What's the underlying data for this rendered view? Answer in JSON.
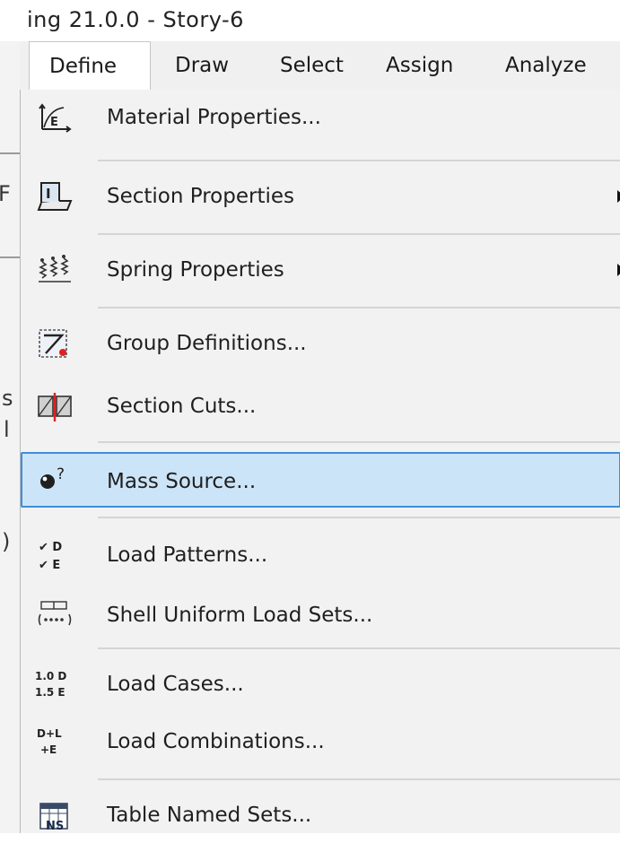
{
  "window": {
    "title_fragment": "ing 21.0.0 - Story-6"
  },
  "left_fragments": [
    "F",
    "s",
    "l",
    ")"
  ],
  "menubar": {
    "items": [
      {
        "label": "Define"
      },
      {
        "label": "Draw"
      },
      {
        "label": "Select"
      },
      {
        "label": "Assign"
      },
      {
        "label": "Analyze"
      }
    ]
  },
  "dropdown": {
    "items": [
      {
        "label": "Material Properties...",
        "icon": "material-properties-icon",
        "icon_text": "E"
      },
      {
        "label": "Section Properties",
        "icon": "section-properties-icon",
        "icon_text": "I",
        "submenu": true
      },
      {
        "label": "Spring Properties",
        "icon": "spring-properties-icon",
        "submenu": true
      },
      {
        "label": "Group Definitions...",
        "icon": "group-definitions-icon"
      },
      {
        "label": "Section Cuts...",
        "icon": "section-cuts-icon"
      },
      {
        "label": "Mass Source...",
        "icon": "mass-source-icon",
        "icon_text": "?",
        "highlighted": true
      },
      {
        "label": "Load Patterns...",
        "icon": "load-patterns-icon",
        "icon_text_1": "✔ D",
        "icon_text_2": "✔ E"
      },
      {
        "label": "Shell Uniform Load Sets...",
        "icon": "shell-uniform-load-sets-icon"
      },
      {
        "label": "Load Cases...",
        "icon": "load-cases-icon",
        "icon_text_1": "1.0 D",
        "icon_text_2": "1.5 E"
      },
      {
        "label": "Load Combinations...",
        "icon": "load-combinations-icon",
        "icon_text_1": "D+L",
        "icon_text_2": "+E"
      },
      {
        "label": "Table Named Sets...",
        "icon": "table-named-sets-icon",
        "icon_text": "NS"
      }
    ]
  },
  "colors": {
    "highlight_bg": "#cce4f7",
    "highlight_border": "#3f8ed6",
    "menu_bg": "#f2f2f2"
  }
}
